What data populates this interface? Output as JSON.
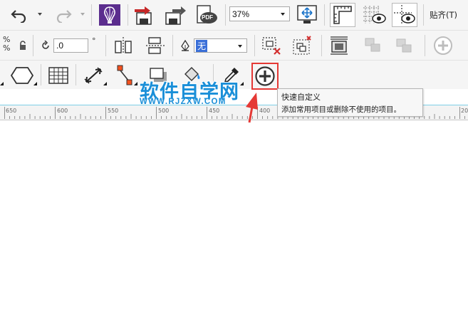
{
  "toolbar_top": {
    "zoom_value": "37%",
    "snap_label": "贴齐(T)",
    "pdf_badge": "PDF"
  },
  "property_bar": {
    "percent_top": "%",
    "percent_bottom": "%",
    "rotation_value": ".0",
    "degree_symbol": "°",
    "outline_value": "无"
  },
  "ruler": {
    "labels": [
      "650",
      "600",
      "550",
      "500",
      "450",
      "400",
      "350",
      "300",
      "250",
      "20"
    ]
  },
  "tooltip": {
    "title": "快速自定义",
    "description": "添加常用项目或删除不使用的项目。"
  },
  "watermark": {
    "name": "软件自学网",
    "url": "WWW.RJZXW.COM"
  },
  "colors": {
    "accent": "#5b2d8e",
    "highlight_box": "#e53935",
    "watermark": "#1a8fd8",
    "ruler_top_line": "#7ecfe6"
  }
}
